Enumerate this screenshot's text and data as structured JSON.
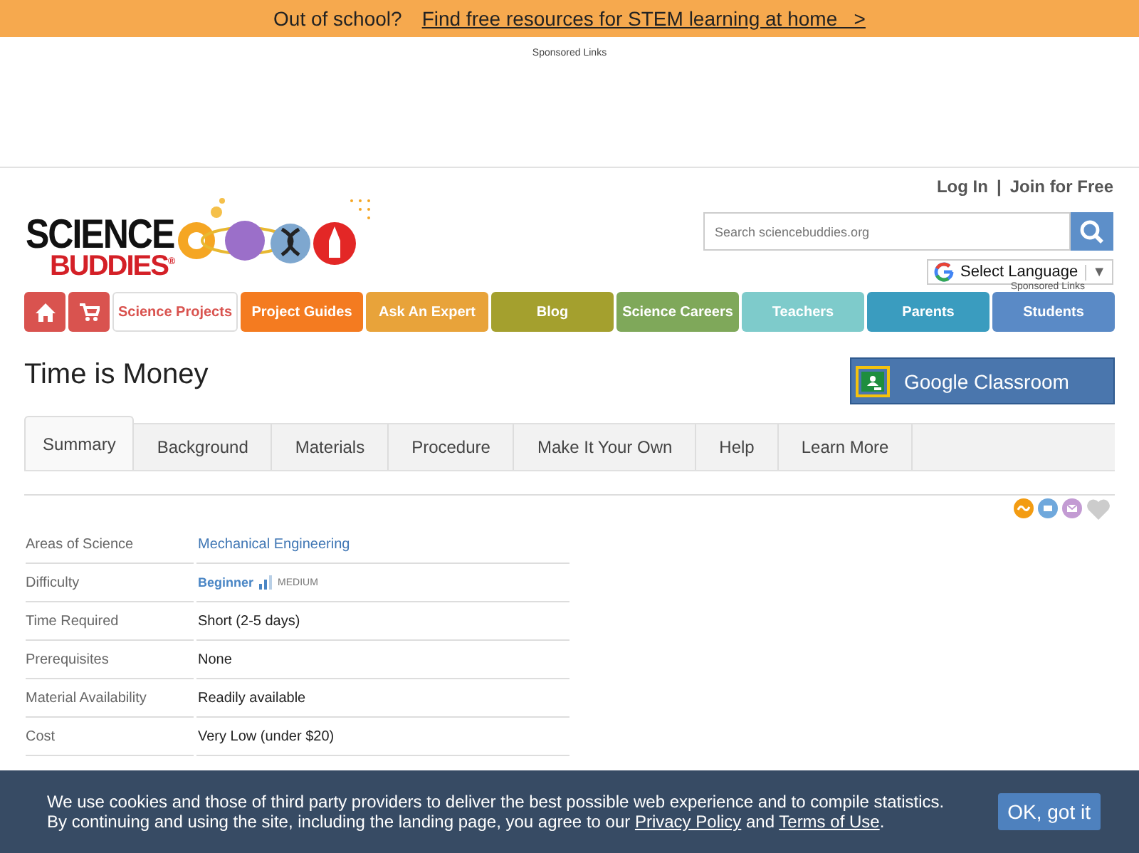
{
  "promo_bar": {
    "lead": "Out of school?",
    "link": "Find free resources for STEM learning at home   >"
  },
  "ad_area": {
    "label": "Sponsored Links"
  },
  "header": {
    "logo_top": "SCIENCE",
    "logo_bottom": "BUDDIES",
    "logo_mark": "®",
    "login": "Log In",
    "separator": "|",
    "join": "Join for Free",
    "search": {
      "placeholder": "Search sciencebuddies.org"
    },
    "language": {
      "label": "Select Language",
      "caret": "▼"
    },
    "sponsored": "Sponsored Links"
  },
  "nav": [
    {
      "kind": "home",
      "color": "#d9534f",
      "selected": false
    },
    {
      "kind": "cart",
      "color": "#d9534f",
      "selected": false
    },
    {
      "kind": "text",
      "label": "Science Projects",
      "color": "#d9534f",
      "selected": true
    },
    {
      "kind": "text",
      "label": "Project Guides",
      "color": "#f47b20",
      "selected": false
    },
    {
      "kind": "text",
      "label": "Ask An Expert",
      "color": "#e8a33a",
      "selected": false
    },
    {
      "kind": "text",
      "label": "Blog",
      "color": "#a4a02e",
      "selected": false
    },
    {
      "kind": "text",
      "label": "Science Careers",
      "color": "#7fa85a",
      "selected": false
    },
    {
      "kind": "text",
      "label": "Teachers",
      "color": "#7ecbcb",
      "selected": false
    },
    {
      "kind": "text",
      "label": "Parents",
      "color": "#3a9cbf",
      "selected": false
    },
    {
      "kind": "text",
      "label": "Students",
      "color": "#5a8ac6",
      "selected": false
    }
  ],
  "page_title": "Time is Money",
  "classroom_button": "Google Classroom",
  "tabs": [
    {
      "label": "Summary",
      "selected": true
    },
    {
      "label": "Background",
      "selected": false
    },
    {
      "label": "Materials",
      "selected": false
    },
    {
      "label": "Procedure",
      "selected": false
    },
    {
      "label": "Make It Your Own",
      "selected": false
    },
    {
      "label": "Help",
      "selected": false
    },
    {
      "label": "Learn More",
      "selected": false
    }
  ],
  "summary": [
    {
      "kind": "link",
      "label": "Areas of Science",
      "value": "Mechanical Engineering"
    },
    {
      "kind": "difficulty",
      "label": "Difficulty",
      "value": "Beginner",
      "extra": "MEDIUM"
    },
    {
      "kind": "text",
      "label": "Time Required",
      "value": "Short (2-5 days)"
    },
    {
      "kind": "text",
      "label": "Prerequisites",
      "value": "None"
    },
    {
      "kind": "text",
      "label": "Material Availability",
      "value": "Readily available"
    },
    {
      "kind": "text",
      "label": "Cost",
      "value": "Very Low (under $20)"
    }
  ],
  "cookie_banner": {
    "line_1": "We use cookies and those of third party providers to deliver the best possible web experience and to compile statistics.",
    "line_2_lead": "By continuing and using the site, including the landing page, you agree to our",
    "privacy": "Privacy Policy",
    "and": "and",
    "terms": "Terms of Use",
    "end": ".",
    "button": "OK, got it"
  }
}
